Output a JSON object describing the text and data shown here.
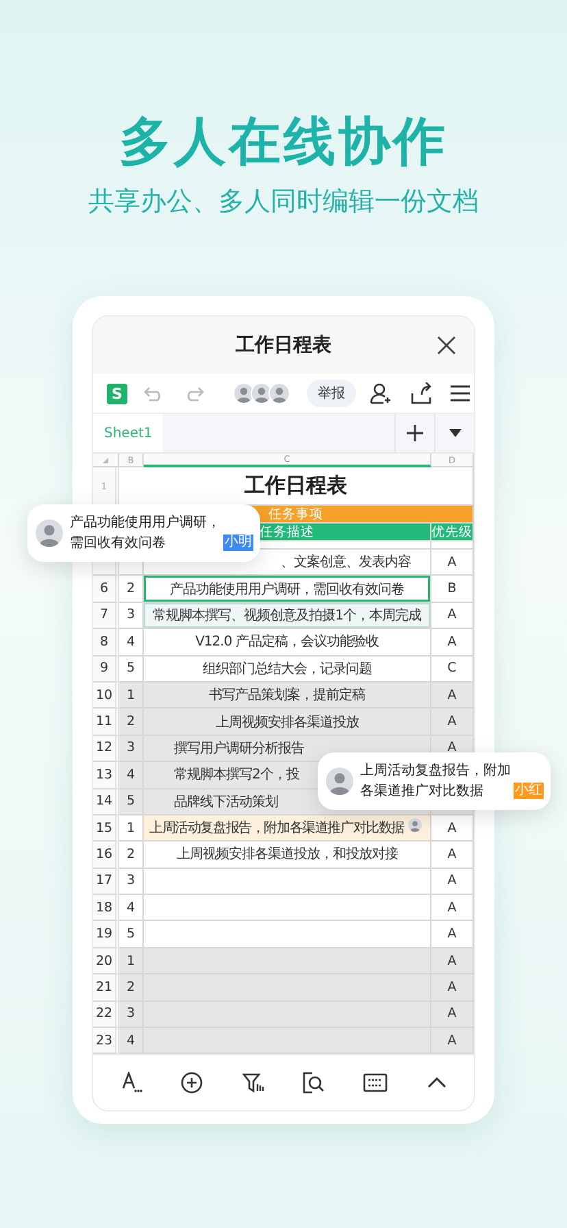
{
  "headline": "多人在线协作",
  "subheadline": "共享办公、多人同时编辑一份文档",
  "document": {
    "title": "工作日程表",
    "app_logo": "S",
    "report_button": "举报"
  },
  "sheet_tabs": [
    {
      "label": "Sheet1",
      "selected": true
    }
  ],
  "columns": [
    "B",
    "C",
    "D"
  ],
  "sheet": {
    "title_row": {
      "row": "1",
      "text": "工作日程表"
    },
    "group_header": "任务事项",
    "column_headers": [
      "任务描述",
      "优先级"
    ],
    "rows": [
      {
        "task": "、文案创意、发表内容",
        "priority": "A",
        "selected": false,
        "shaded": false,
        "in_range": false,
        "commented": false,
        "cut_start": true
      },
      {
        "row": "6",
        "group": "2",
        "task": "产品功能使用用户调研，需回收有效问卷",
        "priority": "B",
        "selected": true,
        "shaded": false,
        "in_range": false,
        "commented": false
      },
      {
        "row": "7",
        "group": "3",
        "task": "常规脚本撰写、视频创意及拍摄1个，本周完成",
        "priority": "A",
        "selected": false,
        "shaded": false,
        "in_range": true,
        "commented": false
      },
      {
        "row": "8",
        "group": "4",
        "task": "V12.0 产品定稿，会议功能验收",
        "priority": "A",
        "selected": false,
        "shaded": false,
        "in_range": false,
        "commented": false
      },
      {
        "row": "9",
        "group": "5",
        "task": "组织部门总结大会，记录问题",
        "priority": "C",
        "selected": false,
        "shaded": false,
        "in_range": false,
        "commented": false
      },
      {
        "row": "10",
        "group": "1",
        "task": "书写产品策划案，提前定稿",
        "priority": "A",
        "selected": false,
        "shaded": true,
        "in_range": false,
        "commented": false
      },
      {
        "row": "11",
        "group": "2",
        "task": "上周视频安排各渠道投放",
        "priority": "A",
        "selected": false,
        "shaded": true,
        "in_range": false,
        "commented": false
      },
      {
        "row": "12",
        "group": "3",
        "task": "撰写用户调研分析报告",
        "priority": "A",
        "selected": false,
        "shaded": true,
        "in_range": false,
        "commented": false,
        "cut_end": true
      },
      {
        "row": "13",
        "group": "4",
        "task": "常规脚本撰写2个，投",
        "selected": false,
        "shaded": true,
        "in_range": false,
        "commented": false,
        "cut_end": true
      },
      {
        "row": "14",
        "group": "5",
        "task": "品牌线下活动策划",
        "selected": false,
        "shaded": true,
        "in_range": false,
        "commented": false,
        "cut_end": true
      },
      {
        "row": "15",
        "group": "1",
        "task": "上周活动复盘报告，附加各渠道推广对比数据",
        "priority": "A",
        "selected": false,
        "shaded": false,
        "in_range": false,
        "commented": true
      },
      {
        "row": "16",
        "group": "2",
        "task": "上周视频安排各渠道投放，和投放对接",
        "priority": "A",
        "selected": false,
        "shaded": false,
        "in_range": false,
        "commented": false
      },
      {
        "row": "17",
        "group": "3",
        "priority": "A",
        "selected": false,
        "shaded": false,
        "in_range": false,
        "commented": false
      },
      {
        "row": "18",
        "group": "4",
        "priority": "A",
        "selected": false,
        "shaded": false,
        "in_range": false,
        "commented": false
      },
      {
        "row": "19",
        "group": "5",
        "priority": "A",
        "selected": false,
        "shaded": false,
        "in_range": false,
        "commented": false
      },
      {
        "row": "20",
        "group": "1",
        "priority": "A",
        "selected": false,
        "shaded": true,
        "in_range": false,
        "commented": false
      },
      {
        "row": "21",
        "group": "2",
        "priority": "A",
        "selected": false,
        "shaded": true,
        "in_range": false,
        "commented": false
      },
      {
        "row": "22",
        "group": "3",
        "priority": "A",
        "selected": false,
        "shaded": true,
        "in_range": false,
        "commented": false
      },
      {
        "row": "23",
        "group": "4",
        "priority": "A",
        "selected": false,
        "shaded": true,
        "in_range": false,
        "commented": false
      }
    ]
  },
  "comments": [
    {
      "text": "产品功能使用用户调研，需回收有效问卷",
      "author_tag": "小明",
      "color": "#3d8bf2"
    },
    {
      "text": "上周活动复盘报告，附加各渠道推广对比数据",
      "author_tag": "小红",
      "color": "#ff9a1e"
    }
  ]
}
